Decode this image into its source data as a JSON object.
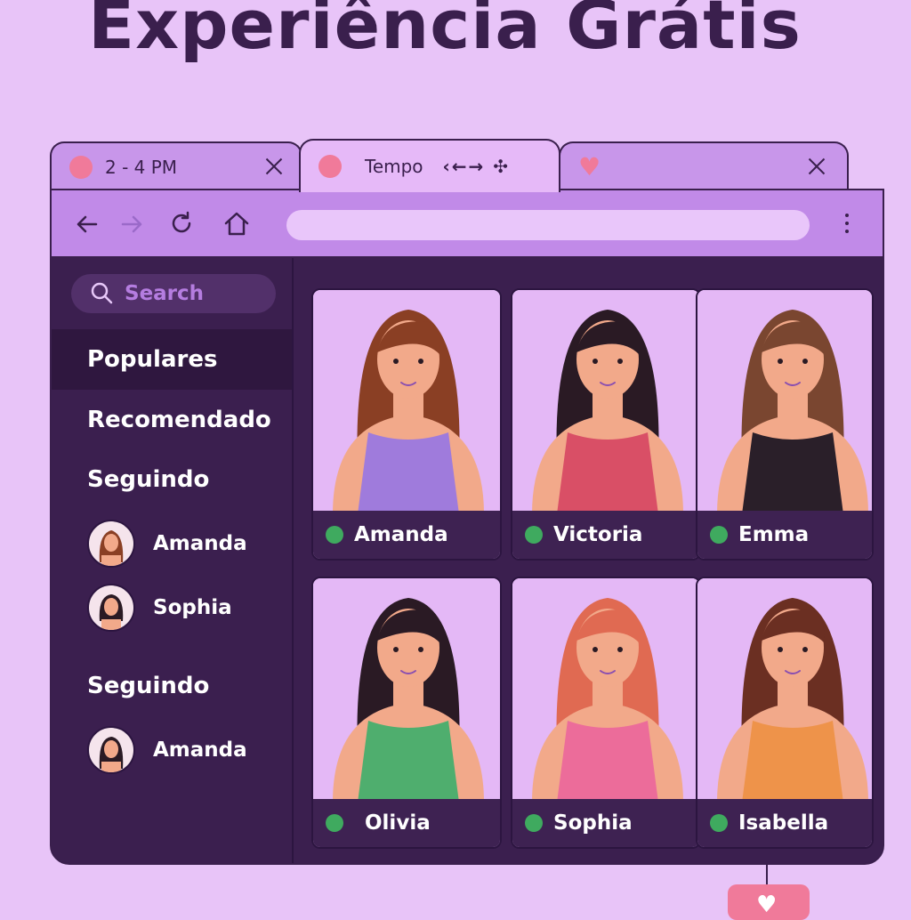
{
  "headline": "Experiência Grátis",
  "tabs": [
    {
      "title": "2 - 4 PM",
      "icon": "pink-dot-icon"
    },
    {
      "title": "Tempo",
      "icon": "pink-dot-icon",
      "controls": "‹←→ ✣"
    },
    {
      "title": "",
      "icon": "heart-icon"
    }
  ],
  "toolbar": {
    "address": "",
    "icons": [
      "back-arrow-icon",
      "forward-arrow-icon",
      "reload-icon",
      "home-icon",
      "kebab-menu-icon"
    ]
  },
  "sidebar": {
    "search_placeholder": "Search",
    "nav": [
      "Populares",
      "Recomendado"
    ],
    "sections": [
      {
        "label": "Seguindo",
        "people": [
          "Amanda",
          "Sophia"
        ]
      },
      {
        "label": "Seguindo",
        "people": [
          "Amanda"
        ]
      }
    ]
  },
  "cards": [
    {
      "name": "Amanda",
      "online": true,
      "hair": "#8a3f24",
      "top": "#9f7bdc"
    },
    {
      "name": "Victoria",
      "online": true,
      "hair": "#2a1a24",
      "top": "#d94f66"
    },
    {
      "name": "Emma",
      "online": true,
      "hair": "#7a4630",
      "top": "#2a1f29"
    },
    {
      "name": "Olivia",
      "online": true,
      "hair": "#2a1a24",
      "top": "#4fae6e"
    },
    {
      "name": "Sophia",
      "online": true,
      "hair": "#e06a52",
      "top": "#ec6c9a"
    },
    {
      "name": "Isabella",
      "online": true,
      "hair": "#6b2f22",
      "top": "#ee934a"
    }
  ],
  "colors": {
    "background": "#e8c4f8",
    "accent": "#c18ae8",
    "dark": "#3b1f4f",
    "online": "#3faa5f",
    "pink": "#f07a9a"
  }
}
